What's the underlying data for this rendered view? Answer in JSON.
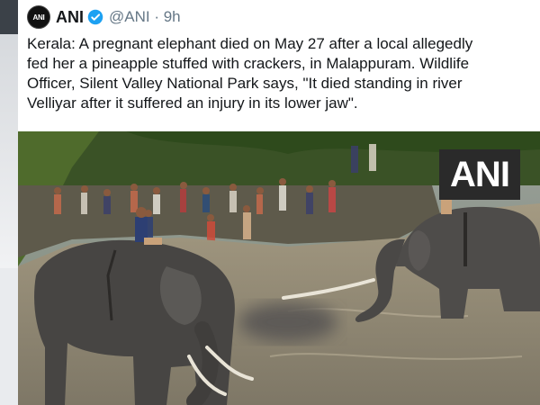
{
  "tweet": {
    "author_name": "ANI",
    "avatar_text": "ANI",
    "handle_time": "@ANI · 9h",
    "text_lines": [
      "Kerala: A pregnant elephant died on May 27 after a local allegedly",
      "fed her a pineapple stuffed with crackers, in Malappuram. Wildlife",
      "Officer, Silent Valley National Park says, \"It died standing in river",
      "Velliyar after it suffered an injury in its lower jaw\"."
    ]
  },
  "media": {
    "watermark": "ANI",
    "icons": {
      "verified": "verified-badge-icon"
    }
  },
  "colors": {
    "verified": "#1da1f2",
    "handle": "#657786",
    "water": "#8f8770",
    "foliage": "#2f4a1e"
  }
}
